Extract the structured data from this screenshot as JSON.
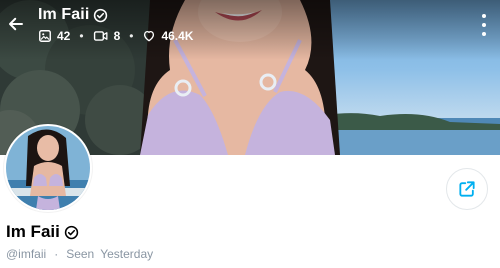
{
  "header": {
    "title": "Im Faii",
    "verified_icon": "verified-check-icon",
    "stats": {
      "photos": "42",
      "videos": "8",
      "likes": "46.4K"
    },
    "icons": {
      "back": "arrow-left-icon",
      "photos": "image-icon",
      "videos": "video-icon",
      "likes": "heart-icon",
      "more": "more-vertical-icon"
    }
  },
  "profile": {
    "name": "Im Faii",
    "handle": "@imfaii",
    "status_label": "Seen",
    "last_seen": "Yesterday",
    "share_icon": "share-icon"
  },
  "colors": {
    "accent": "#00aff0",
    "muted_text": "#8a96a3",
    "name_text": "#000000"
  }
}
